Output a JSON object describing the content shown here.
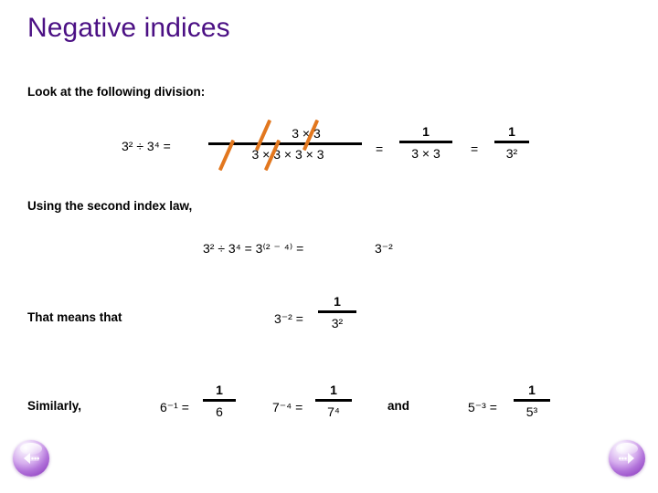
{
  "slide": {
    "title": "Negative indices",
    "title_color": "#4B1084",
    "accent_color": "#E2771E",
    "background": "#ffffff"
  },
  "intro": {
    "text": "Look at the following division:"
  },
  "division_example": {
    "lhs": "3² ÷ 3⁴ =",
    "fraction_numerator": "3 × 3",
    "fraction_denominator": "3 × 3 × 3 × 3",
    "equals_1": "=",
    "result1_numerator": "1",
    "result1_denominator": "3 × 3",
    "equals_2": "=",
    "result2_numerator": "1",
    "result2_denominator": "3²",
    "cancel_marks": 4
  },
  "index_law": {
    "heading": "Using the second index law,",
    "expression": "3² ÷ 3⁴ = 3⁽² ⁻ ⁴⁾ =",
    "result": "3⁻²"
  },
  "means_that": {
    "label": "That means that",
    "expression_lhs": "3⁻² =",
    "numerator": "1",
    "denominator": "3²"
  },
  "similarly": {
    "label": "Similarly,",
    "conjunction": "and",
    "items": [
      {
        "lhs": "6⁻¹ =",
        "numerator": "1",
        "denominator": "6"
      },
      {
        "lhs": "7⁻⁴ =",
        "numerator": "1",
        "denominator": "7⁴"
      },
      {
        "lhs": "5⁻³ =",
        "numerator": "1",
        "denominator": "5³"
      }
    ]
  },
  "navigation": {
    "prev_label": "Previous slide",
    "next_label": "Next slide",
    "prev_icon": "triangle-left-dots-icon",
    "next_icon": "dots-triangle-right-icon"
  }
}
